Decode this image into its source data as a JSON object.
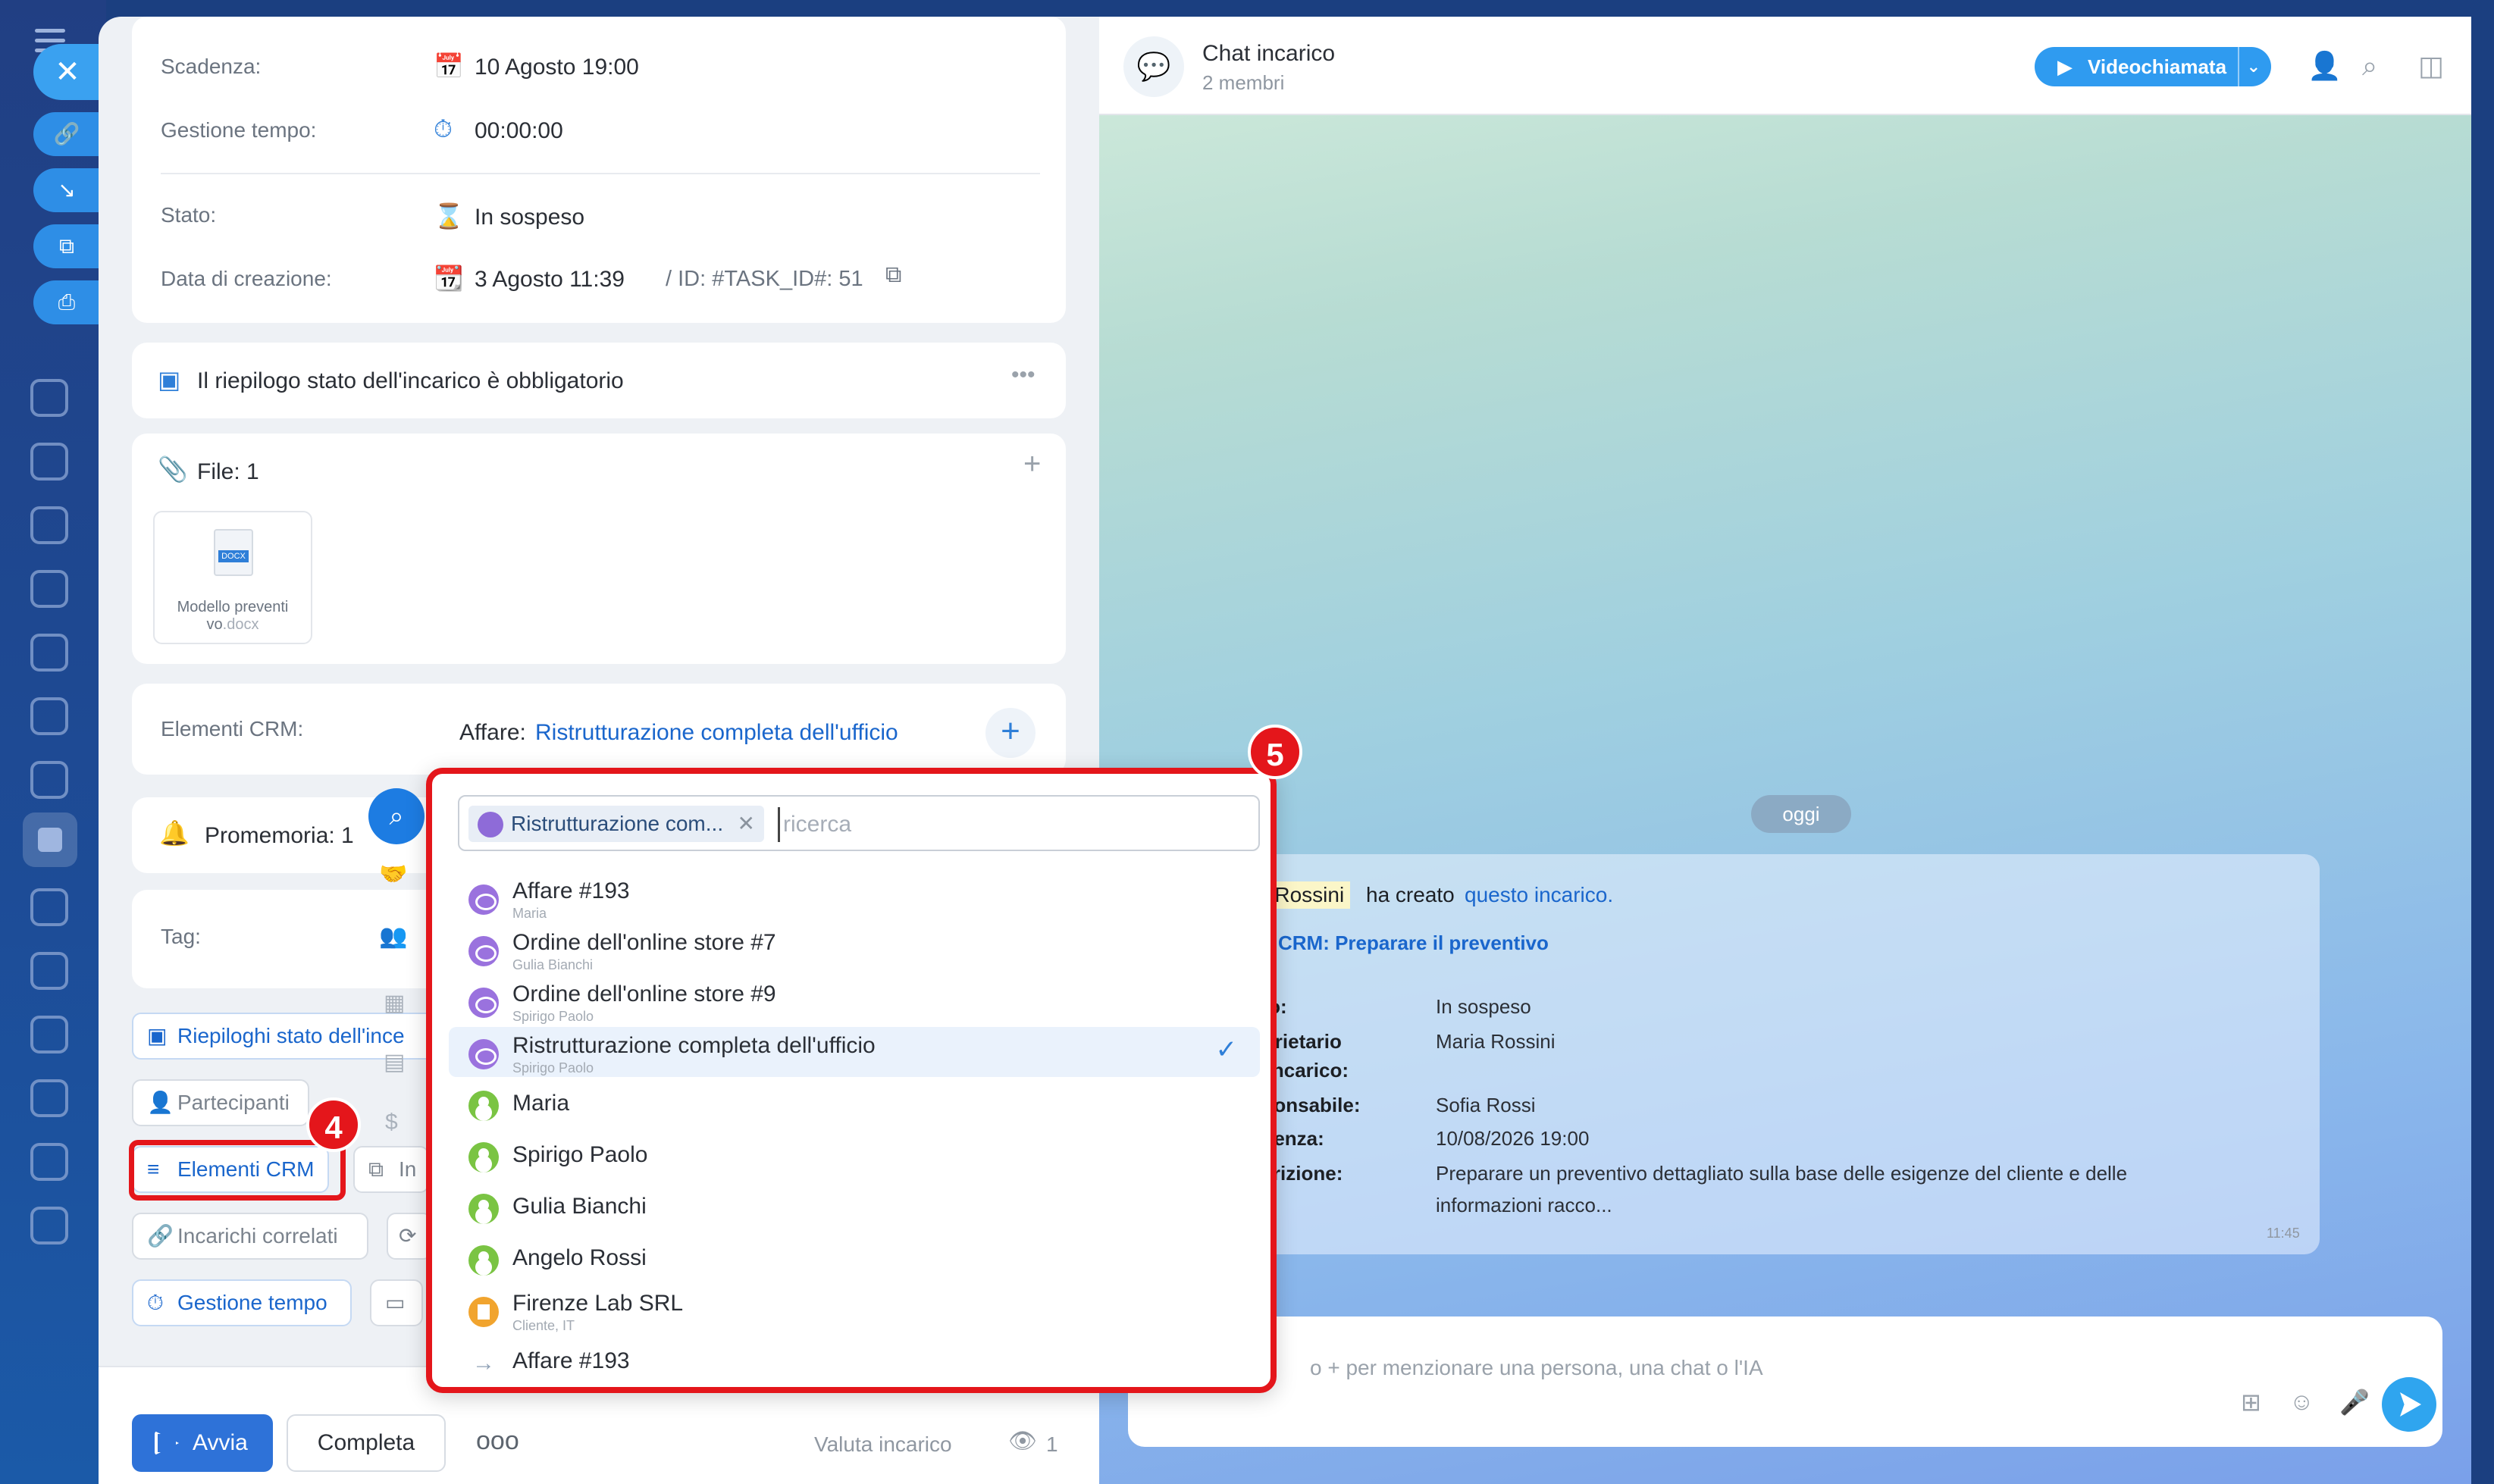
{
  "task": {
    "scadenza_label": "Scadenza:",
    "scadenza_value": "10 Agosto 19:00",
    "gestione_label": "Gestione tempo:",
    "gestione_value": "00:00:00",
    "stato_label": "Stato:",
    "stato_value": "In sospeso",
    "creazione_label": "Data di creazione:",
    "creazione_value": "3 Agosto 11:39",
    "task_id": "/ ID: #TASK_ID#: 51",
    "riepilogo": "Il riepilogo stato dell'incarico è obbligatorio",
    "files_label": "File: 1",
    "file_name_1": "Modello preventi",
    "file_name_2": "vo",
    "file_ext": ".docx",
    "file_type": "DOCX",
    "crm_label": "Elementi CRM:",
    "crm_prefix": "Affare:",
    "crm_link": "Ristrutturazione completa dell'ufficio",
    "promemoria": "Promemoria: 1",
    "tag_label": "Tag:",
    "buttons": {
      "riepiloghi": "Riepiloghi stato dell'ince",
      "partecipanti": "Partecipanti",
      "elementi_crm": "Elementi CRM",
      "in": "In",
      "incarichi": "Incarichi correlati",
      "gestione": "Gestione tempo"
    },
    "footer": {
      "avvia": "Avvia",
      "completa": "Completa",
      "valuta": "Valuta incarico",
      "views": "1"
    }
  },
  "chat": {
    "title": "Chat incarico",
    "members": "2 membri",
    "video_btn": "Videochiamata",
    "date": "oggi",
    "author": "a Rossini",
    "created_text": "ha creato",
    "created_link": "questo incarico.",
    "crm_title": "CRM: Preparare il preventivo",
    "rows": [
      {
        "label": "ato:",
        "value": "In sospeso"
      },
      {
        "label": "oprietario",
        "value": "Maria Rossini"
      },
      {
        "label": "ll'incarico:",
        "value": ""
      },
      {
        "label": "sponsabile:",
        "value": "Sofia Rossi"
      },
      {
        "label": "adenza:",
        "value": "10/08/2026 19:00"
      },
      {
        "label": "scrizione:",
        "value": "Preparare un preventivo dettagliato sulla base delle esigenze del cliente e delle"
      },
      {
        "label": "",
        "value": "informazioni racco..."
      }
    ],
    "time": "11:45",
    "composer_placeholder": "o + per menzionare una persona, una chat o l'IA"
  },
  "dropdown": {
    "chip": "Ristrutturazione com...",
    "search_placeholder": "ricerca",
    "items": [
      {
        "title": "Affare #193",
        "sub": "Maria"
      },
      {
        "title": "Ordine dell'online store #7",
        "sub": "Gulia Bianchi"
      },
      {
        "title": "Ordine dell'online store #9",
        "sub": "Spirigo Paolo"
      },
      {
        "title": "Ristrutturazione completa dell'ufficio",
        "sub": "Spirigo Paolo"
      },
      {
        "title": "Maria",
        "sub": ""
      },
      {
        "title": "Spirigo Paolo",
        "sub": ""
      },
      {
        "title": "Gulia Bianchi",
        "sub": ""
      },
      {
        "title": "Angelo Rossi",
        "sub": ""
      },
      {
        "title": "Firenze Lab SRL",
        "sub": "Cliente, IT"
      },
      {
        "title": "Affare #193",
        "sub": ""
      }
    ]
  },
  "badges": {
    "four": "4",
    "five": "5"
  },
  "colors": {
    "accent": "#2e72d8",
    "highlight": "#e4161b"
  }
}
